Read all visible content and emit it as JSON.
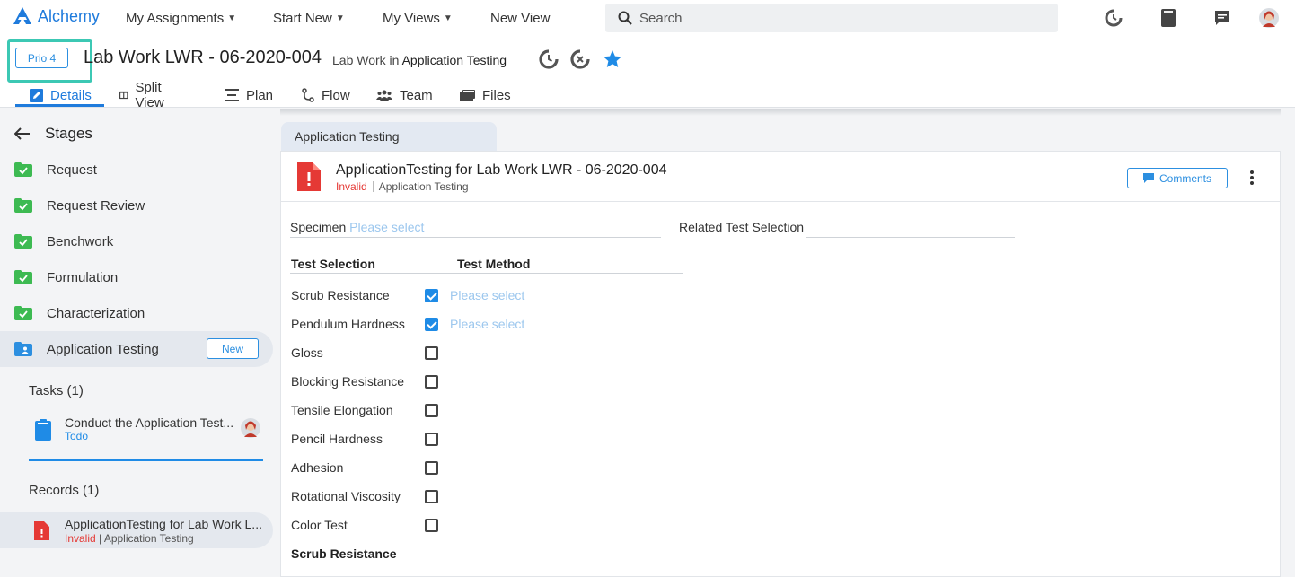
{
  "nav": {
    "brand": "Alchemy",
    "links": [
      {
        "label": "My Assignments",
        "dropdown": true
      },
      {
        "label": "Start New",
        "dropdown": true
      },
      {
        "label": "My Views",
        "dropdown": true
      },
      {
        "label": "New View",
        "dropdown": false
      }
    ],
    "search_placeholder": "Search",
    "accent": "#1f7bdc"
  },
  "header": {
    "priority": "Prio 4",
    "title": "Lab Work LWR - 06-2020-004",
    "subtitle_prefix": "Lab Work in",
    "subtitle_location": "Application Testing",
    "tabs": [
      {
        "label": "Details",
        "icon": "edit-doc-icon",
        "active": true
      },
      {
        "label": "Split View",
        "icon": "split-view-icon",
        "active": false
      },
      {
        "label": "Plan",
        "icon": "plan-icon",
        "active": false
      },
      {
        "label": "Flow",
        "icon": "flow-icon",
        "active": false
      },
      {
        "label": "Team",
        "icon": "team-icon",
        "active": false
      },
      {
        "label": "Files",
        "icon": "files-icon",
        "active": false
      }
    ]
  },
  "sidebar": {
    "stages_title": "Stages",
    "stages": [
      {
        "label": "Request",
        "status": "done"
      },
      {
        "label": "Request Review",
        "status": "done"
      },
      {
        "label": "Benchwork",
        "status": "done"
      },
      {
        "label": "Formulation",
        "status": "done"
      },
      {
        "label": "Characterization",
        "status": "done"
      },
      {
        "label": "Application Testing",
        "status": "active"
      }
    ],
    "new_label": "New",
    "tasks_title": "Tasks (1)",
    "task": {
      "title": "Conduct the Application Test...",
      "status": "Todo"
    },
    "records_title": "Records (1)",
    "record": {
      "title": "ApplicationTesting for Lab Work L...",
      "status": "Invalid",
      "location": "Application Testing"
    }
  },
  "main": {
    "crumb": "Application Testing",
    "title": "ApplicationTesting for Lab Work LWR - 06-2020-004",
    "status": "Invalid",
    "location": "Application Testing",
    "comments_label": "Comments",
    "specimen_label": "Specimen",
    "specimen_placeholder": "Please select",
    "related_label": "Related Test Selection",
    "col_selection": "Test Selection",
    "col_method": "Test Method",
    "tests": [
      {
        "name": "Scrub Resistance",
        "checked": true,
        "method": "Please select"
      },
      {
        "name": "Pendulum Hardness",
        "checked": true,
        "method": "Please select"
      },
      {
        "name": "Gloss",
        "checked": false,
        "method": ""
      },
      {
        "name": "Blocking Resistance",
        "checked": false,
        "method": ""
      },
      {
        "name": "Tensile Elongation",
        "checked": false,
        "method": ""
      },
      {
        "name": "Pencil Hardness",
        "checked": false,
        "method": ""
      },
      {
        "name": "Adhesion",
        "checked": false,
        "method": ""
      },
      {
        "name": "Rotational Viscosity",
        "checked": false,
        "method": ""
      },
      {
        "name": "Color Test",
        "checked": false,
        "method": ""
      }
    ],
    "sub_heading": "Scrub Resistance"
  }
}
